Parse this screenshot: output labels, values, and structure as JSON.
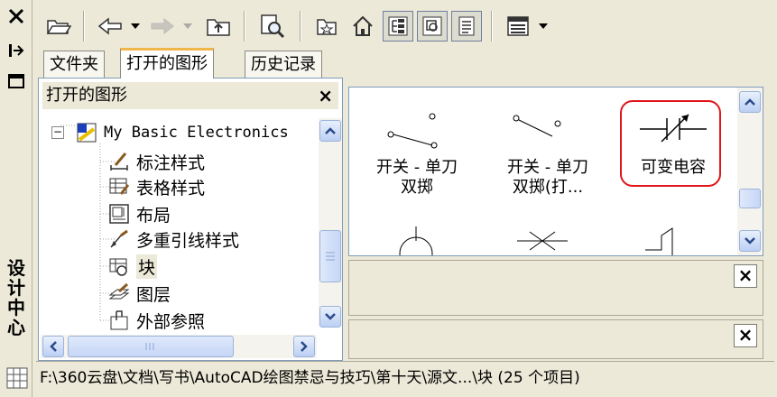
{
  "window": {
    "title_vertical": [
      "设",
      "计",
      "中",
      "心"
    ]
  },
  "tabs": [
    {
      "label": "文件夹"
    },
    {
      "label": "打开的图形"
    },
    {
      "label": "历史记录"
    }
  ],
  "tree": {
    "header": "打开的图形",
    "close_symbol": "×",
    "root": {
      "expander": "−",
      "label": "My Basic Electronics"
    },
    "children": [
      {
        "label": "标注样式",
        "icon": "dimension-style-icon"
      },
      {
        "label": "表格样式",
        "icon": "table-style-icon"
      },
      {
        "label": "布局",
        "icon": "layout-icon"
      },
      {
        "label": "多重引线样式",
        "icon": "multileader-style-icon"
      },
      {
        "label": "块",
        "icon": "block-icon",
        "selected": true
      },
      {
        "label": "图层",
        "icon": "layer-icon"
      },
      {
        "label": "外部参照",
        "icon": "xref-icon"
      }
    ]
  },
  "palette": {
    "items": [
      {
        "label_line1": "开关 - 单刀",
        "label_line2": "双掷"
      },
      {
        "label_line1": "开关 - 单刀",
        "label_line2": "双掷(打..."
      },
      {
        "label_line1": "可变电容",
        "label_line2": ""
      }
    ],
    "highlight_color": "#e0151a"
  },
  "panes": {
    "close_symbol": "×"
  },
  "status": {
    "path": "F:\\360云盘\\文档\\写书\\AutoCAD绘图禁忌与技巧\\第十天\\源文...\\块 (25 个项目)"
  },
  "colors": {
    "background": "#ece9d8",
    "scroll_blue": "#c6d6f6",
    "tab_accent": "#f1b64a"
  }
}
